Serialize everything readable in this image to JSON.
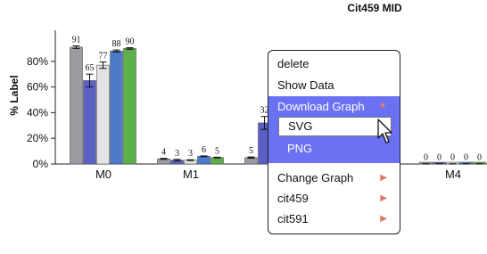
{
  "chart_data": {
    "type": "bar",
    "title": "Cit459 MID",
    "ylabel": "% Label",
    "ylim": [
      0,
      100
    ],
    "yticks": [
      "0%",
      "20%",
      "40%",
      "60%",
      "80%"
    ],
    "categories": [
      "M0",
      "M1",
      "M2",
      "M3",
      "M4"
    ],
    "category_labels": [
      "M0",
      "M1",
      "",
      "",
      "M4"
    ],
    "series_colors": [
      "#9b9ba1",
      "#5b60c4",
      "#e1e3e5",
      "#4b7bc9",
      "#5cb24a"
    ],
    "values": [
      [
        91,
        65,
        77,
        88,
        90
      ],
      [
        4,
        3,
        3,
        6,
        5
      ],
      [
        5,
        32,
        0,
        0,
        0
      ],
      [
        0,
        0,
        0,
        0,
        0
      ],
      [
        0,
        0,
        0,
        0,
        0
      ]
    ],
    "errors": [
      [
        1,
        5,
        2.5,
        0.8,
        0.6
      ],
      [
        0.4,
        0.6,
        0.3,
        0.3,
        0.3
      ],
      [
        0.5,
        5,
        0,
        0,
        0
      ],
      [
        0,
        0,
        0,
        0,
        0
      ],
      [
        0.2,
        0.2,
        0.2,
        0.2,
        0.2
      ]
    ],
    "value_labels": [
      [
        "91",
        "65",
        "77",
        "88",
        "90"
      ],
      [
        "4",
        "3",
        "3",
        "6",
        "5"
      ],
      [
        "5",
        "32",
        "",
        "",
        ""
      ],
      [
        "",
        "",
        "",
        "",
        ""
      ],
      [
        "0",
        "0",
        "0",
        "0",
        "0"
      ]
    ],
    "grid": false,
    "legend": "none"
  },
  "context_menu": {
    "items": {
      "delete": "delete",
      "show_data": "Show Data",
      "download_graph": "Download Graph",
      "svg": "SVG",
      "png": "PNG",
      "change_graph": "Change Graph",
      "cit459": "cit459",
      "cit591": "cit591"
    },
    "highlight_color": "#6a71f2",
    "submenu_arrow_color": "#e0786a"
  }
}
